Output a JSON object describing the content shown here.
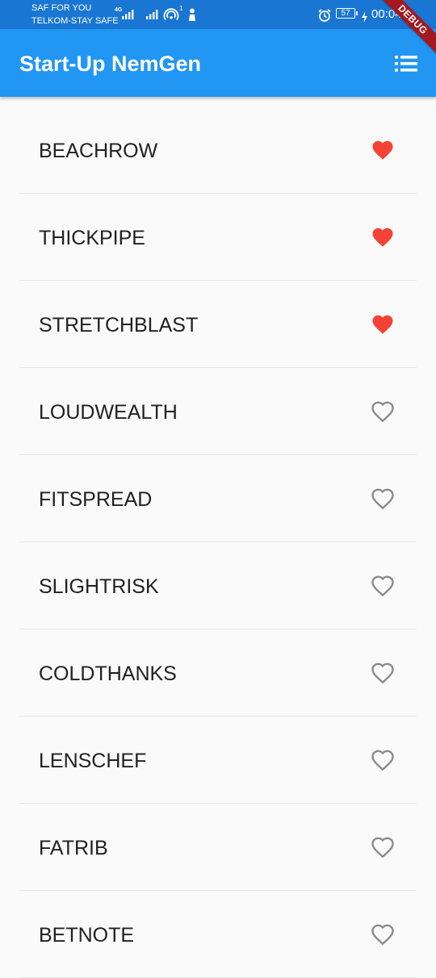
{
  "status_bar": {
    "carrier_1": "SAF FOR YOU",
    "carrier_2": "TELKOM-STAY SAFE",
    "network_type": "4G",
    "hotspot_count": "1",
    "battery": "57",
    "time": "00:04"
  },
  "app_bar": {
    "title": "Start-Up NemGen",
    "menu_icon": "list-icon",
    "debug_label": "DEBUG"
  },
  "colors": {
    "app_bar": "#2196f3",
    "status_bar": "#1976d2",
    "favorite": "#f44336",
    "unfavorite": "#8a8a8a"
  },
  "items": [
    {
      "name": "BEACHROW",
      "saved": true
    },
    {
      "name": "THICKPIPE",
      "saved": true
    },
    {
      "name": "STRETCHBLAST",
      "saved": true
    },
    {
      "name": "LOUDWEALTH",
      "saved": false
    },
    {
      "name": "FITSPREAD",
      "saved": false
    },
    {
      "name": "SLIGHTRISK",
      "saved": false
    },
    {
      "name": "COLDTHANKS",
      "saved": false
    },
    {
      "name": "LENSCHEF",
      "saved": false
    },
    {
      "name": "FATRIB",
      "saved": false
    },
    {
      "name": "BETNOTE",
      "saved": false
    }
  ]
}
